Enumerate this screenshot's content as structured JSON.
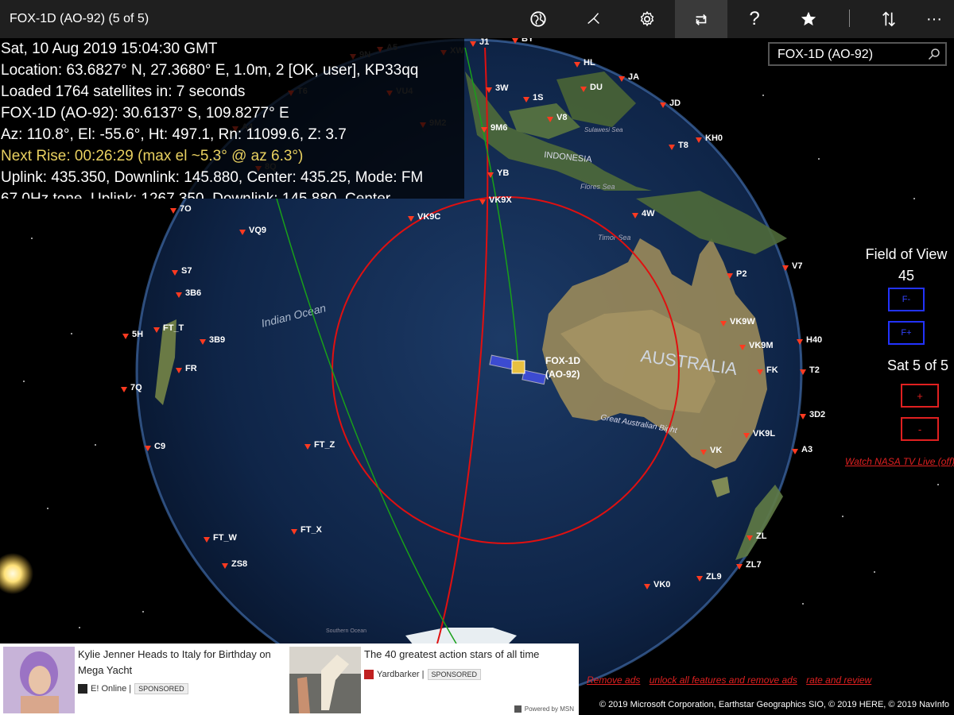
{
  "window": {
    "title": "FOX-1D (AO-92) (5 of 5)"
  },
  "toolbar": {
    "buttons": [
      {
        "name": "globe-icon"
      },
      {
        "name": "tracks-icon"
      },
      {
        "name": "settings-icon"
      },
      {
        "name": "repeat-icon",
        "active": true
      },
      {
        "name": "help-icon"
      },
      {
        "name": "favorite-icon"
      },
      {
        "name": "sort-icon"
      },
      {
        "name": "more-icon"
      }
    ],
    "help_glyph": "?",
    "more_glyph": "···"
  },
  "info": {
    "lines": [
      "Sat, 10 Aug 2019 15:04:30 GMT",
      "Location:  63.6827° N, 27.3680° E, 1.0m, 2 [OK, user], KP33qq",
      "Loaded 1764 satellites in: 7 seconds",
      "FOX-1D (AO-92):  30.6137° S, 109.8277° E",
      "Az:  110.8°, El: -55.6°, Ht: 497.1, Rn: 11099.6, Z: 3.7",
      "Next Rise:  00:26:29 (max el ~5.3° @ az 6.3°)",
      "Uplink:  435.350, Downlink:  145.880, Center:  435.25, Mode:  FM",
      "67.0Hz tone, Uplink: 1267.350, Downlink: 145.880, Center"
    ]
  },
  "search": {
    "value": "FOX-1D (AO-92)"
  },
  "fov": {
    "label": "Field of View",
    "value": "45",
    "minus": "F-",
    "plus": "F+"
  },
  "sat_nav": {
    "label": "Sat 5 of 5",
    "plus": "+",
    "minus": "-"
  },
  "nasa_link": "Watch NASA TV Live (off)",
  "map": {
    "satellite_label_1": "FOX-1D",
    "satellite_label_2": "(AO-92)",
    "geo_labels": [
      "AUSTRALIA",
      "Indian Ocean",
      "INDONESIA",
      "Great Australian Bight",
      "Flores Sea",
      "Timor Sea",
      "Sulawesi Sea",
      "Southern Ocean"
    ],
    "callsigns": [
      "J1",
      "BY",
      "HL",
      "3W",
      "DU",
      "JA",
      "1S",
      "V8",
      "JD",
      "9M6",
      "KH0",
      "T8",
      "YB",
      "VK9X",
      "VK9C",
      "4W",
      "VQ9",
      "7O",
      "S7",
      "3B6",
      "P2",
      "V7",
      "VK9W",
      "H40",
      "5H",
      "FT_T",
      "3B9",
      "VK9M",
      "FR",
      "FK",
      "T2",
      "7Q",
      "3D2",
      "FT_Z",
      "VK9L",
      "C9",
      "VK",
      "A3",
      "FT_X",
      "FT_W",
      "ZS8",
      "ZL",
      "ZL7",
      "VK0",
      "ZL9",
      "9N",
      "A5",
      "XW",
      "T6",
      "VU4",
      "9M2",
      "A4",
      "8Q"
    ]
  },
  "ads": [
    {
      "headline": "Kylie Jenner Heads to Italy for Birthday on Mega Yacht",
      "source": "E! Online |",
      "sponsored": "SPONSORED"
    },
    {
      "headline": "The 40 greatest action stars of all time",
      "source": "Yardbarker |",
      "sponsored": "SPONSORED"
    }
  ],
  "powered_by": "Powered by MSN",
  "links": [
    "Remove ads",
    "unlock all features and remove ads",
    "rate and review"
  ],
  "copyright": "© 2019 Microsoft Corporation, Earthstar Geographics  SIO, © 2019 HERE, © 2019 NavInfo",
  "colors": {
    "accent_red": "#e02020",
    "accent_blue": "#2233ff",
    "rise_yellow": "#e8d060",
    "titlebar": "#1f1f1f"
  }
}
